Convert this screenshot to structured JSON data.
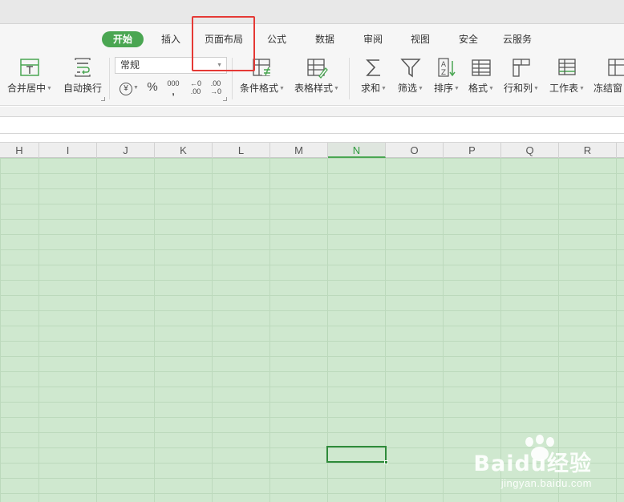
{
  "tabs": [
    {
      "label": "开始",
      "active": true
    },
    {
      "label": "插入"
    },
    {
      "label": "页面布局",
      "highlighted": true
    },
    {
      "label": "公式"
    },
    {
      "label": "数据"
    },
    {
      "label": "审阅"
    },
    {
      "label": "视图"
    },
    {
      "label": "安全"
    },
    {
      "label": "云服务"
    }
  ],
  "ribbon": {
    "merge_center": "合并居中",
    "wrap_text": "自动换行",
    "number_format": "常规",
    "currency": "¥",
    "percent": "%",
    "thousands": "000",
    "thousands_sub": ",",
    "inc_decimal_top": "←0",
    "inc_decimal_bottom": ".00",
    "dec_decimal_top": ".00",
    "dec_decimal_bottom": "→0",
    "conditional_format": "条件格式",
    "table_style": "表格样式",
    "sum": "求和",
    "filter": "筛选",
    "sort": "排序",
    "format": "格式",
    "rows_cols": "行和列",
    "worksheet": "工作表",
    "freeze": "冻结窗"
  },
  "columns": [
    "H",
    "I",
    "J",
    "K",
    "L",
    "M",
    "N",
    "O",
    "P",
    "Q",
    "R"
  ],
  "active_column": "N",
  "watermark": {
    "brand": "Baidu经验",
    "url": "jingyan.baidu.com"
  },
  "colors": {
    "accent": "#4aa652",
    "grid": "#cfe8cf",
    "highlight_box": "#e53935"
  }
}
